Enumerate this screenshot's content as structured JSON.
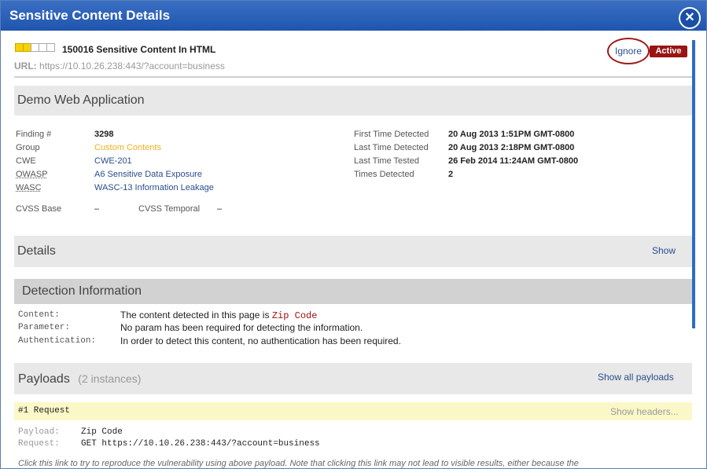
{
  "window": {
    "title": "Sensitive Content Details"
  },
  "header": {
    "severity": {
      "level": 2,
      "max": 5
    },
    "finding_title": "150016 Sensitive Content In HTML",
    "url_label": "URL:",
    "url_value": "https://10.10.26.238:443/?account=business",
    "ignore_label": "Ignore",
    "status": "Active"
  },
  "app_section": {
    "title": "Demo Web Application"
  },
  "finding": {
    "finding_label": "Finding #",
    "finding_value": "3298",
    "group_label": "Group",
    "group_value": "Custom Contents",
    "cwe_label": "CWE",
    "cwe_value": "CWE-201",
    "owasp_label": "OWASP",
    "owasp_value": "A6 Sensitive Data Exposure",
    "wasc_label": "WASC",
    "wasc_value": "WASC-13 Information Leakage",
    "cvss_base_label": "CVSS Base",
    "cvss_base_value": "–",
    "cvss_temporal_label": "CVSS Temporal",
    "cvss_temporal_value": "–",
    "first_detected_label": "First Time Detected",
    "first_detected_value": "20 Aug 2013 1:51PM GMT-0800",
    "last_detected_label": "Last Time Detected",
    "last_detected_value": "20 Aug 2013 2:18PM GMT-0800",
    "last_tested_label": "Last Time Tested",
    "last_tested_value": "26 Feb 2014 11:24AM GMT-0800",
    "times_detected_label": "Times Detected",
    "times_detected_value": "2"
  },
  "details": {
    "title": "Details",
    "show_label": "Show"
  },
  "detection": {
    "title": "Detection Information",
    "content_label": "Content:",
    "content_prefix": "The content detected in this page is",
    "content_value": "Zip Code",
    "parameter_label": "Parameter:",
    "parameter_value": "No param has been required for detecting the information.",
    "auth_label": "Authentication:",
    "auth_value": "In order to detect this content, no authentication has been required."
  },
  "payloads": {
    "title": "Payloads",
    "count": "(2 instances)",
    "show_all_label": "Show all payloads",
    "request_title": "#1 Request",
    "show_headers_label": "Show headers...",
    "payload_label": "Payload:",
    "payload_value": "Zip Code",
    "request_label": "Request:",
    "request_value": "GET https://10.10.26.238:443/?account=business",
    "note": "Click this link to try to reproduce the vulnerability using above payload. Note that clicking this link may not lead to visible results, either because the"
  },
  "colors": {
    "titlebar": "#2a62bb",
    "status_badge": "#9a1414",
    "link": "#2a4d8c",
    "group_gold": "#f0b020",
    "zip_code_red": "#a01010",
    "request_bar": "#fbf8c8"
  }
}
